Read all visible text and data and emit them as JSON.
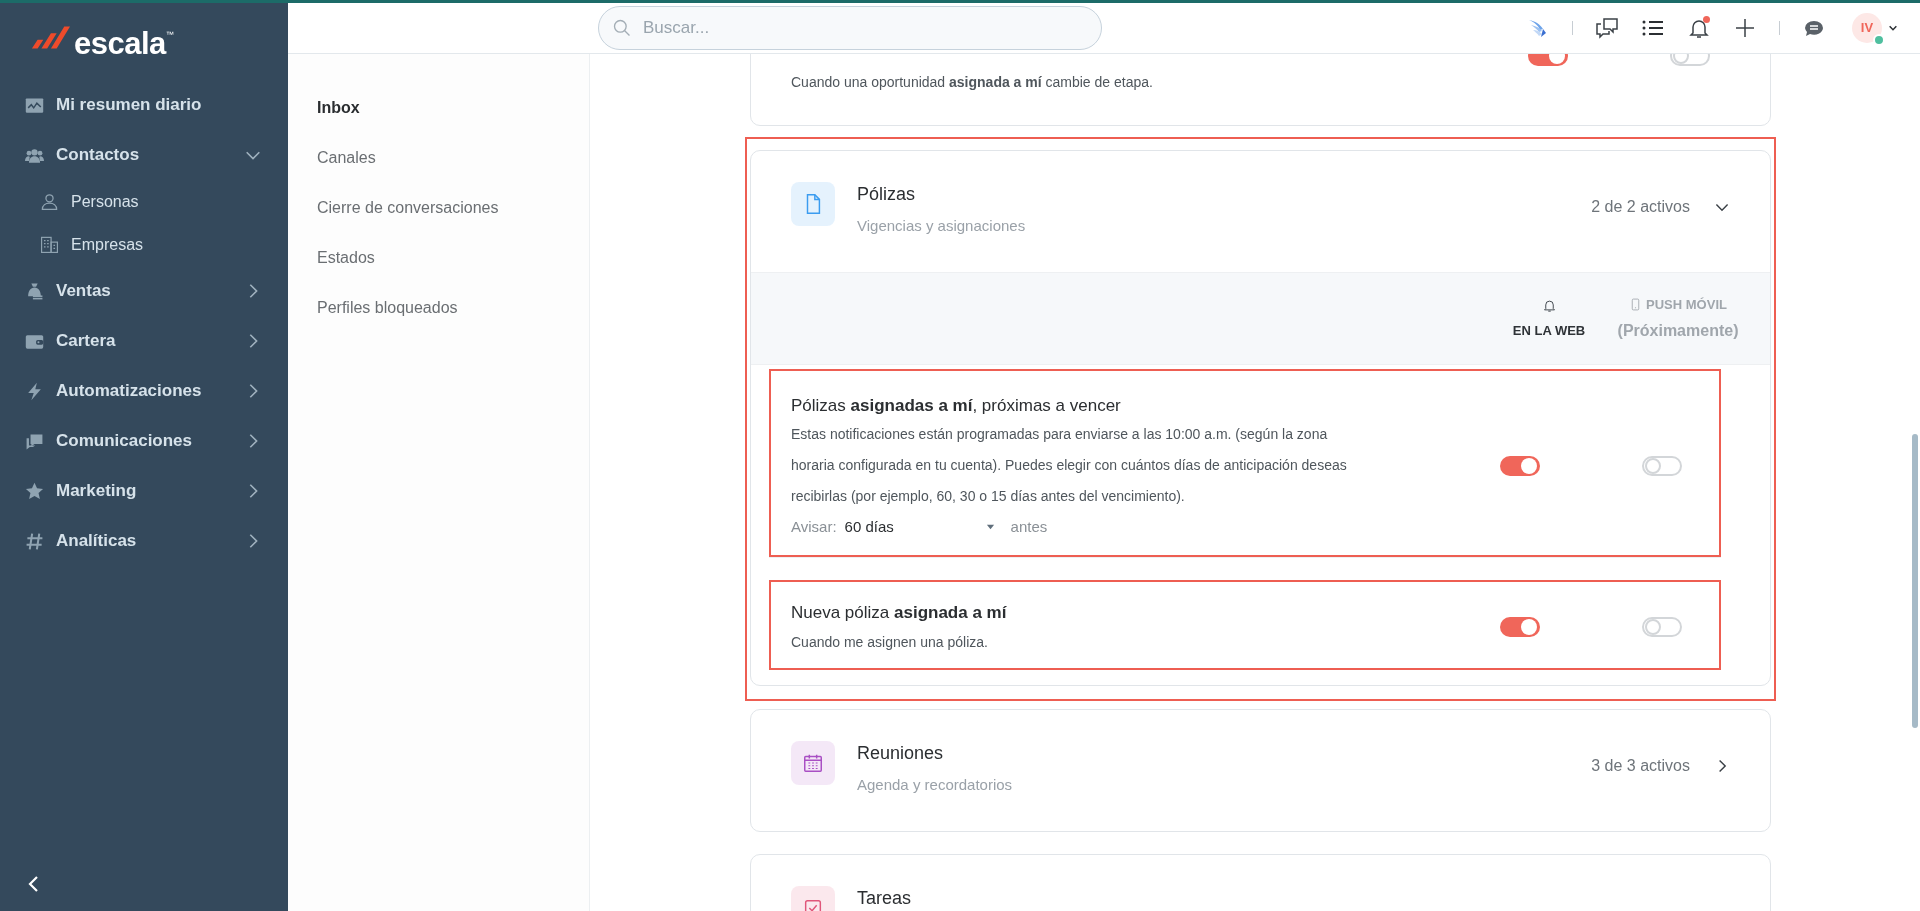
{
  "sidebar": {
    "brand": "escala",
    "brand_mark": "™",
    "items": [
      {
        "label": "Mi resumen diario"
      },
      {
        "label": "Contactos",
        "expanded": true,
        "children": [
          {
            "label": "Personas"
          },
          {
            "label": "Empresas"
          }
        ]
      },
      {
        "label": "Ventas",
        "expanded": false
      },
      {
        "label": "Cartera",
        "expanded": false
      },
      {
        "label": "Automatizaciones",
        "expanded": false
      },
      {
        "label": "Comunicaciones",
        "expanded": false
      },
      {
        "label": "Marketing",
        "expanded": false
      },
      {
        "label": "Analíticas",
        "expanded": false
      }
    ]
  },
  "topbar": {
    "search": {
      "placeholder": "Buscar..."
    },
    "notifications_unread": true,
    "user": {
      "initials": "IV",
      "online": true
    }
  },
  "settings_menu": [
    {
      "label": "Inbox",
      "selected": true
    },
    {
      "label": "Canales",
      "selected": false
    },
    {
      "label": "Cierre de conversaciones",
      "selected": false
    },
    {
      "label": "Estados",
      "selected": false
    },
    {
      "label": "Perfiles bloqueados",
      "selected": false
    }
  ],
  "notification_groups": [
    {
      "kind": "partial",
      "rows": [
        {
          "description": "Cuando una oportunidad **asignada a mí** cambie de etapa.",
          "web_on": true,
          "push_on": false
        }
      ]
    },
    {
      "kind": "group",
      "title": "Pólizas",
      "subtitle": "Vigencias y asignaciones",
      "count": "2 de 2 activos",
      "color": "#3b9cf0",
      "expanded": true,
      "highlighted": true,
      "columns": {
        "web": "EN LA WEB",
        "push": "PUSH MÓVIL",
        "push_note": "(Próximamente)"
      },
      "rows": [
        {
          "title": "Pólizas **asignadas a mí**, próximas a vencer",
          "description": "Estas notificaciones están programadas para enviarse a las 10:00 a.m. (según la zona horaria configurada en tu cuenta). Puedes elegir con cuántos días de anticipación deseas recibirlas (por ejemplo, 60, 30 o 15 días antes del vencimiento).",
          "web_on": true,
          "push_on": false,
          "highlighted": true,
          "setting": {
            "label": "Avisar:",
            "value": "60 días",
            "suffix": "antes"
          }
        },
        {
          "title": "Nueva póliza **asignada a mí**",
          "description": "Cuando me asignen una póliza.",
          "web_on": true,
          "push_on": false,
          "highlighted": true
        }
      ]
    },
    {
      "kind": "group",
      "title": "Reuniones",
      "subtitle": "Agenda y recordatorios",
      "count": "3 de 3 activos",
      "color": "#a94fc4",
      "expanded": false,
      "highlighted": false
    },
    {
      "kind": "group",
      "title": "Tareas",
      "color": "#e0567a",
      "highlighted": false
    }
  ]
}
